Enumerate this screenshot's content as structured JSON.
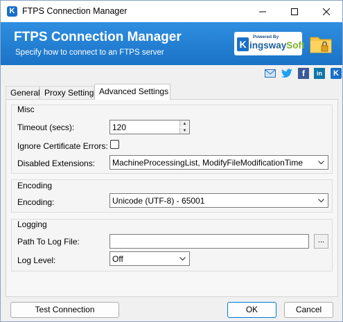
{
  "window": {
    "title": "FTPS Connection Manager"
  },
  "banner": {
    "title": "FTPS Connection Manager",
    "subtitle": "Specify how to connect to an FTPS server",
    "logo_powered": "Powered By",
    "logo_brand_a": "ingsway",
    "logo_brand_b": "Soft",
    "brand_color": "#1a72c6"
  },
  "social_icons": [
    "mail-icon",
    "twitter-icon",
    "facebook-icon",
    "linkedin-icon",
    "kingswaysoft-icon"
  ],
  "tabs": [
    {
      "label": "General",
      "active": false
    },
    {
      "label": "Proxy Settings",
      "active": false
    },
    {
      "label": "Advanced Settings",
      "active": true
    }
  ],
  "misc": {
    "group_label": "Misc",
    "timeout_label": "Timeout (secs):",
    "timeout_value": "120",
    "ignore_cert_label": "Ignore Certificate Errors:",
    "ignore_cert_checked": false,
    "disabled_ext_label": "Disabled Extensions:",
    "disabled_ext_value": "MachineProcessingList, ModifyFileModificationTime"
  },
  "encoding": {
    "group_label": "Encoding",
    "encoding_label": "Encoding:",
    "encoding_value": "Unicode (UTF-8) - 65001"
  },
  "logging": {
    "group_label": "Logging",
    "path_label": "Path To Log File:",
    "path_value": "",
    "browse_label": "...",
    "level_label": "Log Level:",
    "level_value": "Off"
  },
  "buttons": {
    "test_connection": "Test Connection",
    "ok": "OK",
    "cancel": "Cancel"
  }
}
